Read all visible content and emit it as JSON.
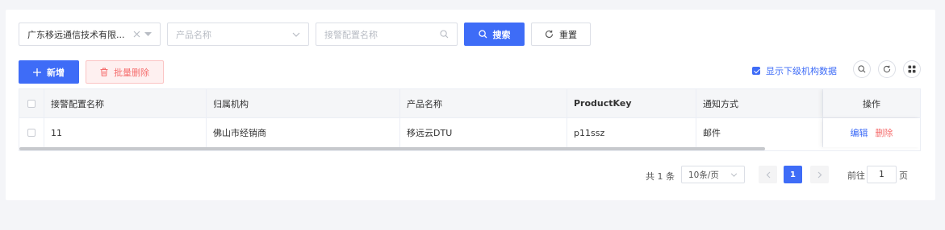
{
  "filters": {
    "org_select": {
      "value": "广东移远通信技术有限..."
    },
    "product_select": {
      "placeholder": "产品名称"
    },
    "alarm_name_input": {
      "placeholder": "接警配置名称"
    }
  },
  "buttons": {
    "search": "搜索",
    "reset": "重置",
    "add": "新增",
    "batch_delete": "批量删除"
  },
  "toolbar": {
    "show_sub_orgs": {
      "label": "显示下级机构数据",
      "checked": true
    }
  },
  "table": {
    "columns": [
      "接警配置名称",
      "归属机构",
      "产品名称",
      "ProductKey",
      "通知方式",
      "操作"
    ],
    "rows": [
      {
        "name": "11",
        "org": "佛山市经销商",
        "product": "移远云DTU",
        "product_key": "p11ssz",
        "notify": "邮件",
        "actions": [
          "编辑",
          "删除"
        ]
      }
    ]
  },
  "pagination": {
    "total_text": "共 1 条",
    "page_size": "10条/页",
    "current_page": "1",
    "goto_label": "前往",
    "goto_value": "1",
    "goto_unit": "页"
  },
  "colors": {
    "primary": "#3e6cf7",
    "danger": "#f56c6c"
  },
  "icons": [
    "clear-icon",
    "caret-down-icon",
    "chevron-down-icon",
    "search-icon",
    "refresh-icon",
    "plus-icon",
    "trash-icon",
    "checkbox-checked-icon",
    "grid-icon",
    "chevron-left-icon",
    "chevron-right-icon"
  ]
}
